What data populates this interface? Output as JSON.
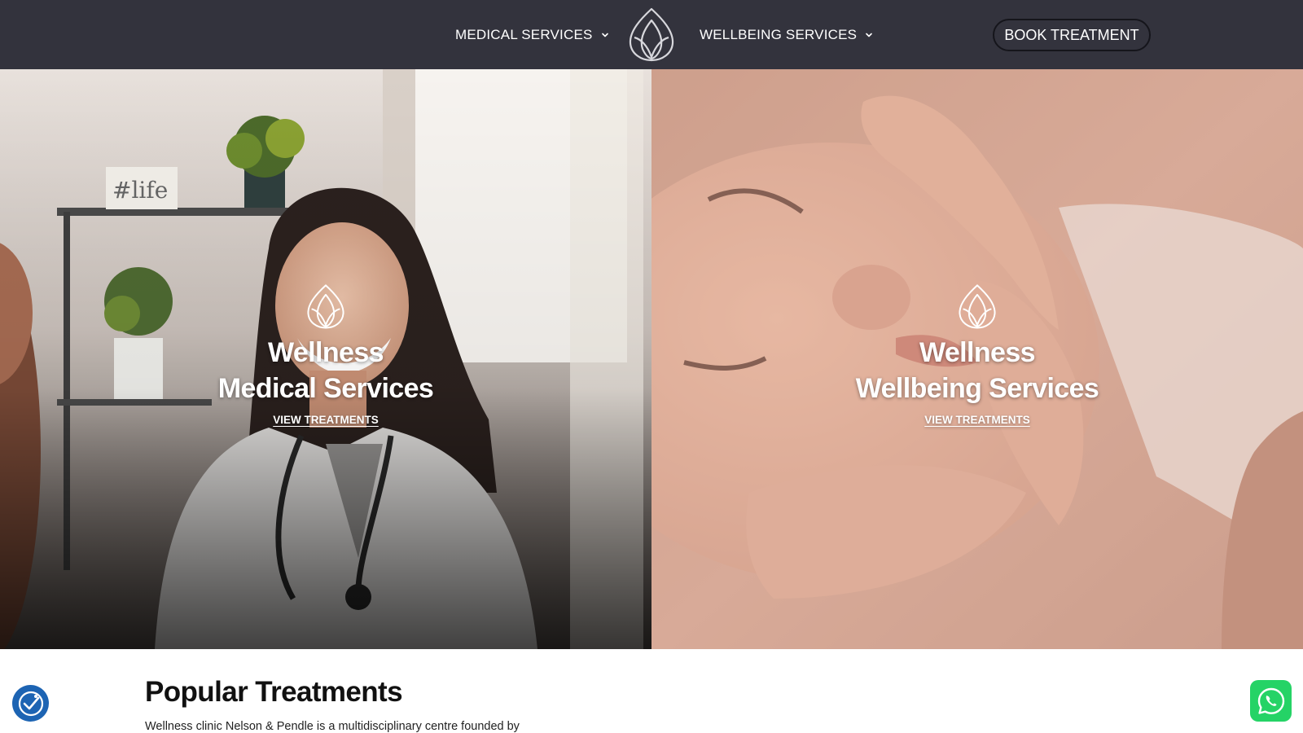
{
  "header": {
    "nav": [
      {
        "label": "MEDICAL SERVICES",
        "icon": "chevron-down-icon"
      },
      {
        "label": "WELLBEING SERVICES",
        "icon": "chevron-down-icon"
      }
    ],
    "logo_icon": "lotus-logo-icon",
    "book_button": "BOOK TREATMENT",
    "colors": {
      "bar": "#33333d",
      "text": "#ffffff"
    }
  },
  "hero": {
    "left": {
      "title_line1": "Wellness",
      "title_line2": "Medical Services",
      "link": "VIEW TREATMENTS",
      "icon": "lotus-icon"
    },
    "right": {
      "title_line1": "Wellness",
      "title_line2": "Wellbeing Services",
      "link": "VIEW TREATMENTS",
      "icon": "lotus-icon"
    }
  },
  "section": {
    "title": "Popular Treatments",
    "text": "Wellness clinic Nelson & Pendle is a multidisciplinary centre founded by"
  },
  "floating": {
    "accessibility_icon": "accessibility-icon",
    "whatsapp_icon": "whatsapp-icon",
    "colors": {
      "accessibility": "#1d64b3",
      "whatsapp": "#25d366"
    }
  }
}
